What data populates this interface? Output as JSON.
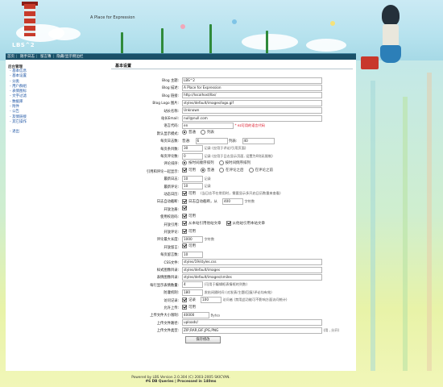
{
  "site": {
    "title": "LBS^2",
    "tagline": "A Place for Expression"
  },
  "topnav": [
    {
      "label": "首页"
    },
    {
      "label": "随手日志"
    },
    {
      "label": "留言簿"
    },
    {
      "label": "隐藏/显示侧边栏"
    }
  ],
  "sidebar": {
    "heading": "后台管理",
    "items": [
      "基本信息",
      "基本设置",
      "分类",
      "用户群组",
      "表情图标",
      "文字过滤",
      "数据库",
      "附件",
      "公告",
      "友情链接",
      "其它操作"
    ],
    "logout": "退出"
  },
  "main": {
    "section_title": "基本设置",
    "fields": {
      "blog_title": {
        "label": "Blog 主题:",
        "value": "LBS^2"
      },
      "blog_desc": {
        "label": "Blog 描述:",
        "value": "A Place for Expression"
      },
      "blog_url": {
        "label": "Blog 链接:",
        "value": "http://localhost/lbs/"
      },
      "blog_logo": {
        "label": "Blog Logo 图片:",
        "value": "styles/default/images/logo.gif"
      },
      "admin_name": {
        "label": "站长名称:",
        "value": "Unknown"
      },
      "admin_email": {
        "label": "站长Email:",
        "value": "null@null.com"
      },
      "lang_code": {
        "label": "语言代码:",
        "value": "en",
        "note": "* ez可用的语言代码"
      },
      "default_mode": {
        "label": "默认显示模式:",
        "opt1": "普通",
        "opt2": "列表"
      },
      "per_page": {
        "label": "每页日志数:",
        "opt1_label": "普通:",
        "opt1_value": "6",
        "opt2_label": "列表:",
        "opt2_value": "40"
      },
      "per_page_comments": {
        "label": "每页条目数:",
        "value": "30",
        "note": "记录 (应用于评论/引用页面)"
      },
      "per_page_reviews": {
        "label": "每页评论数:",
        "value": "0",
        "note": "记录 (应用于日志显示页面, 设置为0则无限制)"
      },
      "comment_sort": {
        "label": "评论排序:",
        "opt1": "按时间顺序排列",
        "opt2": "按时间倒序排列"
      },
      "trackback_pos": {
        "label": "引用和评论一起显示:",
        "opt_enable": "可用",
        "opt1": "普通",
        "opt2": "在评论之后",
        "opt3": "在评论之前"
      },
      "recent_entries": {
        "label": "最新日志:",
        "value": "10",
        "note": "记录"
      },
      "recent_comments": {
        "label": "最新评论:",
        "value": "10",
        "note": "记录"
      },
      "dynamic_log": {
        "label": "动态日历:",
        "opt": "可用",
        "note": "(当日志不在常用时，需要显示多开启日历数量来查看)"
      },
      "auto_split": {
        "label": "日志自动截断:",
        "opt": "日志自动截断，从",
        "value": "400",
        "note": "字符数"
      },
      "enable_register": {
        "label": "开放注册:"
      },
      "use_verify": {
        "label": "使用校验码:",
        "opt": "可用"
      },
      "enable_trackback": {
        "label": "开放引用:",
        "opt1": "从本站引用他站文章",
        "opt2": "从他站引用本站文章"
      },
      "enable_comments": {
        "label": "开放评论:",
        "opt": "可用"
      },
      "min_comment_len": {
        "label": "评论最大长度:",
        "value": "1000",
        "note": "字符数"
      },
      "enable_guestbook": {
        "label": "开放留言:",
        "opt": "可用"
      },
      "per_page_messages": {
        "label": "每页留言数:",
        "value": "10"
      },
      "css_file": {
        "label": "CSS文件:",
        "value": "styles/19/styles.css"
      },
      "style_images": {
        "label": "样式图像目录:",
        "value": "styles/default/images"
      },
      "smiley_dir": {
        "label": "表情图像目录:",
        "value": "styles/default/images/smiles"
      },
      "shown_per_page": {
        "label": "每行显示表情数量:",
        "value": "4",
        "note": "(可用于编辑框表情框的列数)"
      },
      "anti_flood": {
        "label": "防灌机制:",
        "value": "180",
        "note": "发帖间隔时间",
        "note2": "(对发表/主题/回复/评论均有效)"
      },
      "visit_stats": {
        "label": "访问记录:",
        "opt": "记录",
        "value": "100",
        "note": "访问者",
        "note2": "(禁用此功能可不影响方面访问统计)"
      },
      "gzip": {
        "label": "允许上传:",
        "opt": "可用"
      },
      "max_upload": {
        "label": "上传文件大小限制:",
        "value": "40000",
        "note": "Bytes"
      },
      "upload_dir": {
        "label": "上传文件路径:",
        "value": "uploads/"
      },
      "upload_types": {
        "label": "上传文件类型:",
        "value": "ZIP,RAR,GIF,JPG,PNG",
        "note": "(用 , 分开)"
      }
    },
    "save_label": "保存修改"
  },
  "footer": {
    "line1": "Powered by LBS Version 2.0.304 (C) 2003-2005 SKICYAN.",
    "line2": "#6 DB Queries | Processed in 140ms"
  },
  "colors": {
    "nav_bg": "#1a5068",
    "link": "#1e55a4",
    "accent_red": "#d12"
  }
}
